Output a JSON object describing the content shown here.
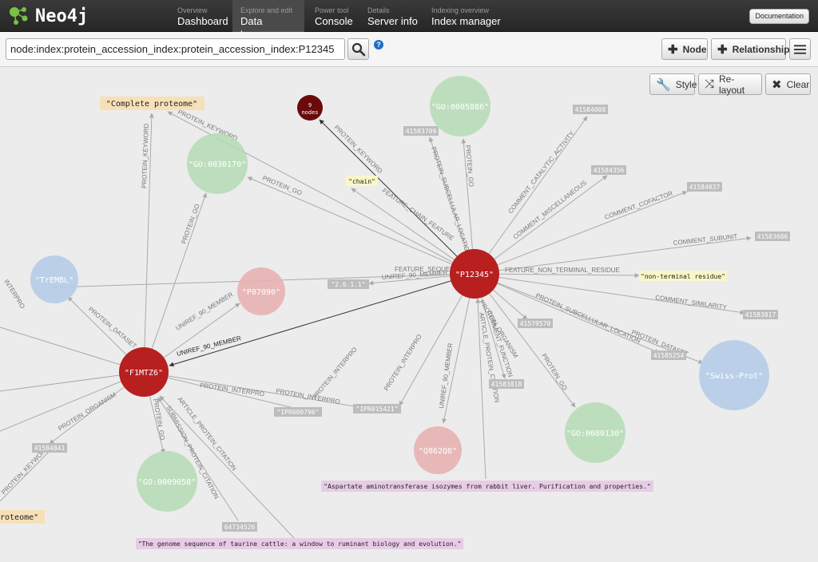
{
  "app": {
    "brand": "Neo4j"
  },
  "nav": [
    {
      "sub": "Overview",
      "label": "Dashboard"
    },
    {
      "sub": "Explore and edit",
      "label": "Data browser"
    },
    {
      "sub": "Power tool",
      "label": "Console"
    },
    {
      "sub": "Details",
      "label": "Server info"
    },
    {
      "sub": "Indexing overview",
      "label": "Index manager"
    }
  ],
  "header": {
    "documentation_label": "Documentation"
  },
  "search": {
    "value": "node:index:protein_accession_index:protein_accession_index:P12345",
    "help": "?"
  },
  "toolbar": {
    "node_label": "Node",
    "relationship_label": "Relationship"
  },
  "viz_toolbar": {
    "style_label": "Style",
    "relayout_label": "Re-layout",
    "clear_label": "Clear"
  },
  "colors": {
    "node_dark_red": "#b81f1f",
    "node_pink": "#e8b3b3",
    "node_green": "#b5dcb5",
    "node_blue": "#b6cde8",
    "badge_gray": "#bdbdbd"
  },
  "graph": {
    "nodes": {
      "p12345": "\"P12345\"",
      "f1mtz6": "\"F1MTZ6\"",
      "p07090": "\"P07090\"",
      "q86q8": "\"Q862Q8\"",
      "go5886": "\"GO:0005886\"",
      "go30170": "\"GO:0030170\"",
      "go80130": "\"GO:0080130\"",
      "go9058": "\"GO:0009058\"",
      "trembl": "\"TrEMBL\"",
      "swissprot": "\"Swiss-Prot\"",
      "nodes_count": "9",
      "nodes_word": "nodes"
    },
    "notes": {
      "complete_proteome": "\"Complete proteome\"",
      "complete_proteome_cut": "roteome\"",
      "chain": "\"chain\"",
      "non_terminal": "\"non-terminal residue\"",
      "aspartate": "\"Aspartate aminotransferase isozymes from rabbit liver. Purification and properties.\"",
      "genome": "\"The genome sequence of taurine cattle: a window to ruminant biology and evolution.\""
    },
    "badges": {
      "b1": "41583709",
      "b2": "41584008",
      "b3": "41584356",
      "b4": "41584037",
      "b5": "41583686",
      "b6": "41583817",
      "b7": "41585254",
      "b8": "41579570",
      "b9": "41583818",
      "b10": "\"2.6.1.1\"",
      "b11": "\"IPR000796\"",
      "b12": "\"IPR015421\"",
      "b13": "41584841",
      "b14": "64734526"
    },
    "edges": {
      "protein_keyword": "PROTEIN_KEYWORD",
      "protein_go": "PROTEIN_GO",
      "protein_subcellular": "PROTEIN_SUBCELLULAR_LOCATION",
      "comment_catalytic": "COMMENT_CATALYTIC_ACTIVITY",
      "comment_misc": "COMMENT_MISCELLANEOUS",
      "comment_cofactor": "COMMENT_COFACTOR",
      "comment_subunit": "COMMENT_SUBUNIT",
      "feature_nonterm": "FEATURE_NON_TERMINAL_RESIDUE",
      "comment_similarity": "COMMENT_SIMILARITY",
      "protein_dataset": "PROTEIN_DATASET",
      "feature_chain": "FEATURE_CHAIN_FEATURE",
      "feature_seq": "FEATURE_SEQUENCE",
      "uniref_member": "UNIREF_90_MEMBER",
      "protein_interpro": "PROTEIN_INTERPRO",
      "protein_organism": "PROTEIN_ORGANISM",
      "comment_function": "COMMENT_FUNCTION",
      "article_citation": "ARTICLE_PROTEIN_CITATION",
      "submission_citation": "SUBMISSION_PROTEIN_CITATION"
    }
  }
}
